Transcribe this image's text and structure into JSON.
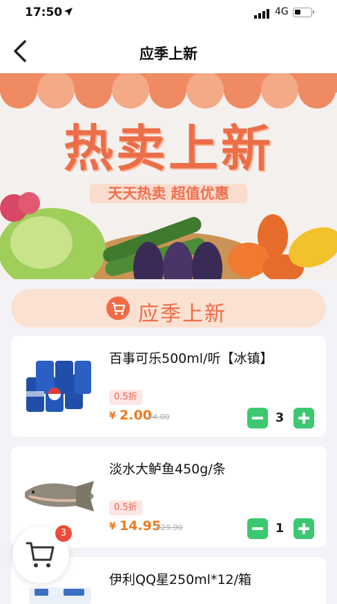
{
  "status_bar": {
    "time": "17:50",
    "network": "4G"
  },
  "nav": {
    "title": "应季上新"
  },
  "banner": {
    "title": "热卖上新",
    "subtitle": "天天热卖 超值优惠"
  },
  "section": {
    "title": "应季上新"
  },
  "products": [
    {
      "name": "百事可乐500ml/听【冰镇】",
      "discount": "0.5折",
      "currency": "¥",
      "price": "2.00",
      "original_price": "¥4.00",
      "quantity": "3"
    },
    {
      "name": "淡水大鲈鱼450g/条",
      "discount": "0.5折",
      "currency": "¥",
      "price": "14.95",
      "original_price": "¥29.90",
      "quantity": "1"
    },
    {
      "name": "伊利QQ星250ml*12/箱"
    }
  ],
  "cart": {
    "count": "3"
  },
  "colors": {
    "accent": "#ef6b45",
    "price": "#f07a1e",
    "qty_button": "#3bc870",
    "badge": "#ec4a3a"
  }
}
